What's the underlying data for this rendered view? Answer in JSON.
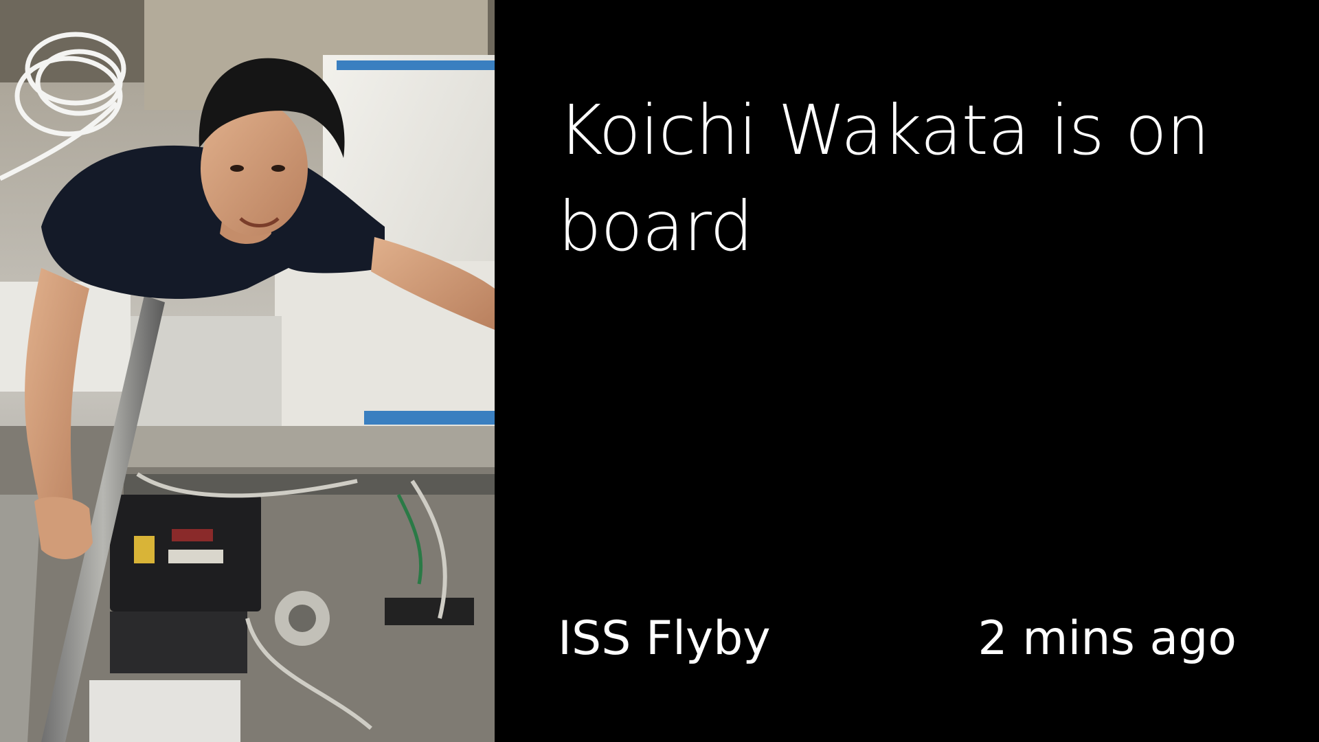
{
  "card": {
    "headline": "Koichi Wakata is on board",
    "source": "ISS Flyby",
    "timestamp": "2 mins ago",
    "background_color": "#000000",
    "text_color": "#ffffff"
  },
  "photo": {
    "icon": "astronaut-photo"
  }
}
